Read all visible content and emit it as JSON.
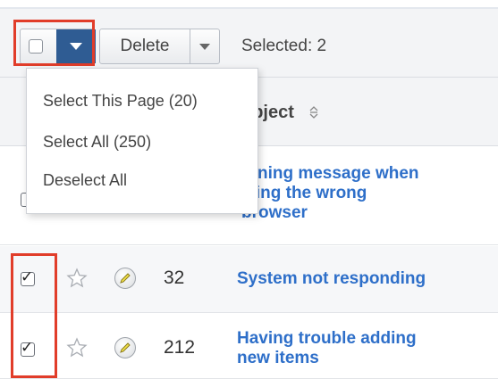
{
  "toolbar": {
    "delete_label": "Delete",
    "selected_text": "Selected: 2"
  },
  "dropdown_menu": {
    "items": [
      {
        "label": "Select This Page (20)"
      },
      {
        "label": "Select All (250)"
      },
      {
        "label": "Deselect All"
      }
    ]
  },
  "table": {
    "subject_header": "ubject",
    "rows": [
      {
        "number": "",
        "subject_lines": [
          "arning message when",
          "ising the wrong",
          "browser"
        ],
        "checked": false
      },
      {
        "number": "32",
        "subject_lines": [
          "System not responding"
        ],
        "checked": true
      },
      {
        "number": "212",
        "subject_lines": [
          "Having trouble adding",
          "new items"
        ],
        "checked": true
      }
    ]
  },
  "icons": {
    "select_checkbox": "checkbox-icon",
    "select_caret": "chevron-down-icon",
    "delete_caret": "chevron-down-icon",
    "sort": "sort-icon",
    "favorite": "star-icon",
    "edit": "pencil-icon"
  },
  "colors": {
    "accent": "#2f5c93",
    "link": "#2e6fc9",
    "highlight": "#e13d2a"
  }
}
